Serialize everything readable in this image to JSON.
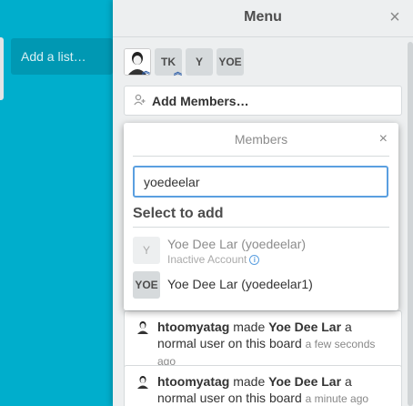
{
  "board": {
    "add_list_label": "Add a list…"
  },
  "menu": {
    "title": "Menu",
    "close_icon": "×",
    "members": [
      {
        "initials": "",
        "type": "photo",
        "admin": true
      },
      {
        "initials": "TK",
        "type": "initials",
        "admin": true
      },
      {
        "initials": "Y",
        "type": "initials",
        "admin": false
      },
      {
        "initials": "YOE",
        "type": "initials",
        "admin": false
      }
    ],
    "add_members_label": "Add Members…",
    "activities": [
      {
        "user": "htoomyatag",
        "action": "made",
        "target": "Yoe Dee Lar",
        "rest": "a normal user on this board",
        "time": "a few seconds ago"
      },
      {
        "user": "htoomyatag",
        "action": "made",
        "target": "Yoe Dee Lar",
        "rest": "a normal user on this board",
        "time": "a minute ago"
      }
    ]
  },
  "popover": {
    "title": "Members",
    "close_icon": "×",
    "search_value": "yoedeelar",
    "section_label": "Select to add",
    "results": [
      {
        "initials": "Y",
        "name": "Yoe Dee Lar (yoedeelar)",
        "sub": "Inactive Account",
        "inactive": true
      },
      {
        "initials": "YOE",
        "name": "Yoe Dee Lar (yoedeelar1)",
        "sub": "",
        "inactive": false
      }
    ]
  },
  "colors": {
    "board_bg": "#00aecc",
    "sidebar_bg": "#edeff0",
    "input_focus": "#5a9fe0",
    "admin_badge": "#2e5ea8"
  }
}
